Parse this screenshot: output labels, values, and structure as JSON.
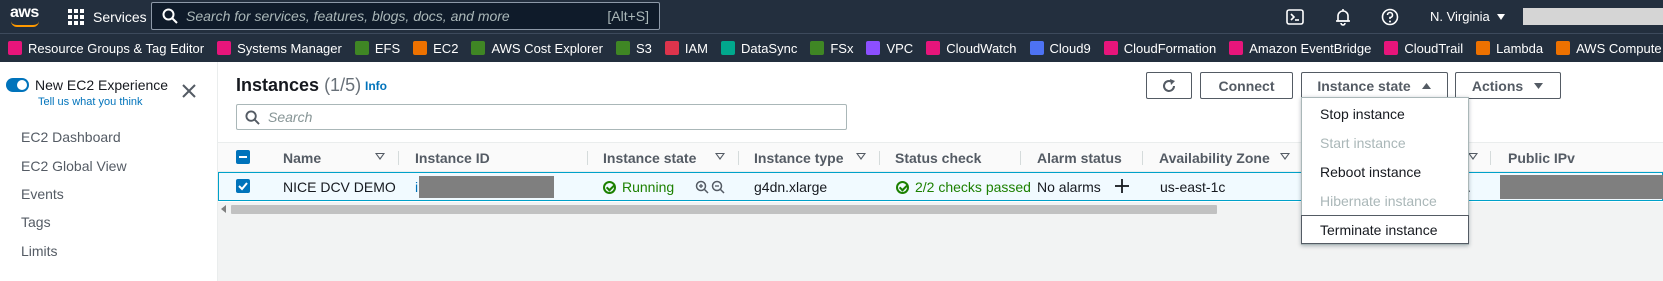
{
  "topnav": {
    "logo_text": "aws",
    "services_label": "Services",
    "search_placeholder": "Search for services, features, blogs, docs, and more",
    "search_shortcut": "[Alt+S]",
    "region": "N. Virginia"
  },
  "favorites": [
    {
      "label": "Resource Groups & Tag Editor",
      "color": "#e7157b"
    },
    {
      "label": "Systems Manager",
      "color": "#e7157b"
    },
    {
      "label": "EFS",
      "color": "#3f8624"
    },
    {
      "label": "EC2",
      "color": "#ed7100"
    },
    {
      "label": "AWS Cost Explorer",
      "color": "#3f8624"
    },
    {
      "label": "S3",
      "color": "#3f8624"
    },
    {
      "label": "IAM",
      "color": "#dd344c"
    },
    {
      "label": "DataSync",
      "color": "#01a88d"
    },
    {
      "label": "FSx",
      "color": "#3f8624"
    },
    {
      "label": "VPC",
      "color": "#8c4fff"
    },
    {
      "label": "CloudWatch",
      "color": "#e7157b"
    },
    {
      "label": "Cloud9",
      "color": "#4d72f3"
    },
    {
      "label": "CloudFormation",
      "color": "#e7157b"
    },
    {
      "label": "Amazon EventBridge",
      "color": "#e7157b"
    },
    {
      "label": "CloudTrail",
      "color": "#e7157b"
    },
    {
      "label": "Lambda",
      "color": "#ed7100"
    },
    {
      "label": "AWS Compute",
      "color": "#ed7100"
    }
  ],
  "sidenav": {
    "experience_label": "New EC2 Experience",
    "tell_us": "Tell us what you think",
    "links": [
      "EC2 Dashboard",
      "EC2 Global View",
      "Events",
      "Tags",
      "Limits"
    ]
  },
  "instances": {
    "title": "Instances",
    "count": "(1/5)",
    "info": "Info",
    "search_placeholder": "Search",
    "buttons": {
      "connect": "Connect",
      "instance_state": "Instance state",
      "actions": "Actions"
    },
    "columns": {
      "name": "Name",
      "instance_id": "Instance ID",
      "instance_state": "Instance state",
      "instance_type": "Instance type",
      "status_check": "Status check",
      "alarm_status": "Alarm status",
      "availability_zone": "Availability Zone",
      "public_ipv4": "Public IPv"
    },
    "row": {
      "name": "NICE DCV DEMO",
      "instance_id_prefix": "i",
      "state": "Running",
      "type": "g4dn.xlarge",
      "status_check": "2/2 checks passed",
      "alarm_status": "No alarms",
      "az": "us-east-1c",
      "trailing_fragment": "."
    }
  },
  "state_menu": {
    "items": [
      {
        "label": "Stop instance",
        "enabled": true
      },
      {
        "label": "Start instance",
        "enabled": false
      },
      {
        "label": "Reboot instance",
        "enabled": true
      },
      {
        "label": "Hibernate instance",
        "enabled": false
      },
      {
        "label": "Terminate instance",
        "enabled": true
      }
    ]
  }
}
